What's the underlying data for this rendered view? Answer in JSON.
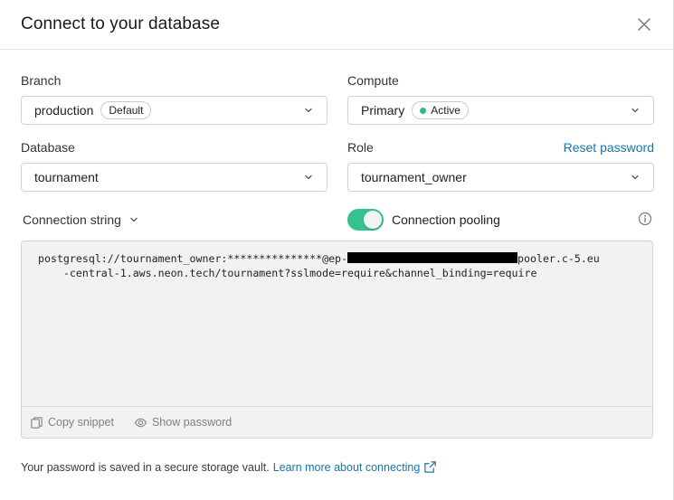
{
  "dialog": {
    "title": "Connect to your database"
  },
  "branch": {
    "label": "Branch",
    "value": "production",
    "badge": "Default"
  },
  "compute": {
    "label": "Compute",
    "value": "Primary",
    "badge": "Active",
    "badge_dot_color": "#2fb985"
  },
  "database": {
    "label": "Database",
    "value": "tournament"
  },
  "role": {
    "label": "Role",
    "value": "tournament_owner",
    "reset_link": "Reset password"
  },
  "connection": {
    "label": "Connection string",
    "pooling_label": "Connection pooling",
    "pooling_enabled": true,
    "toggle_color": "#34c38f",
    "line1_prefix": "postgresql://tournament_owner:***************@ep-",
    "line1_suffix": "pooler.c-5.eu",
    "line2": "    -central-1.aws.neon.tech/tournament?sslmode=require&channel_binding=require"
  },
  "code_footer": {
    "copy_label": "Copy snippet",
    "show_label": "Show password"
  },
  "footer_note": {
    "text": "Your password is saved in a secure storage vault.",
    "link": "Learn more about connecting"
  },
  "colors": {
    "link": "#1a73a8",
    "code_bg": "#f2f2f2"
  }
}
